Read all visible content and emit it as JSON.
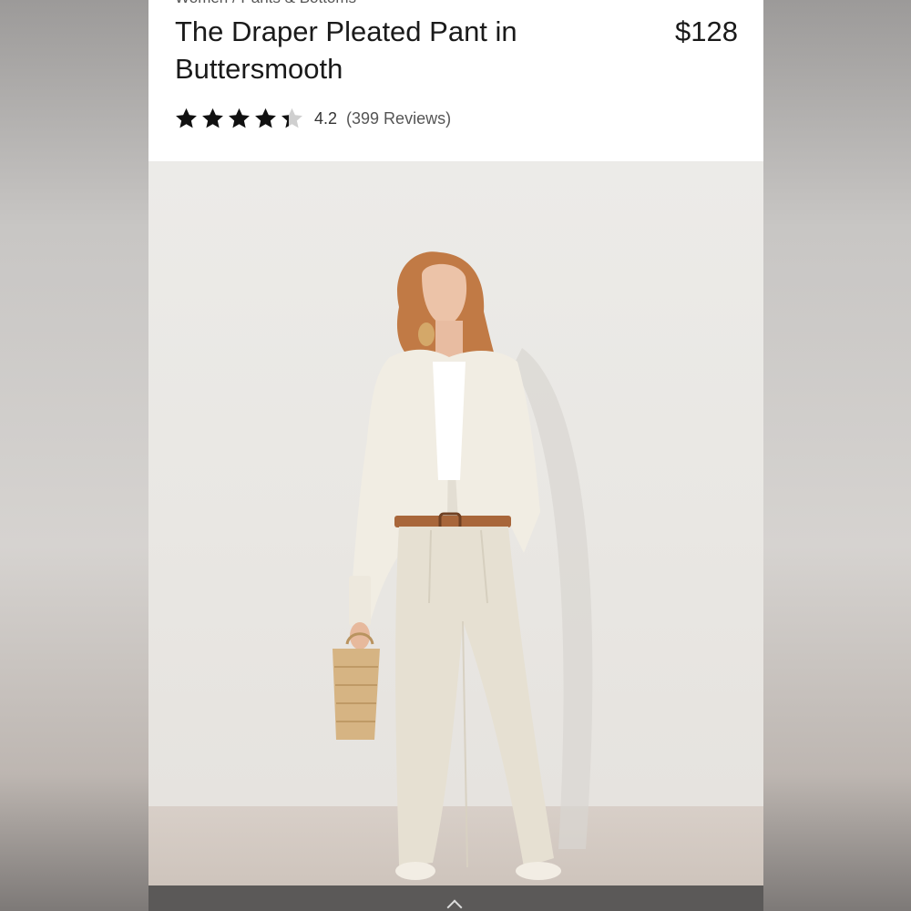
{
  "breadcrumb": {
    "text": "Women / Pants & Bottoms"
  },
  "product": {
    "title": "The Draper Pleated Pant in Buttersmooth",
    "price": "$128",
    "rating_value": "4.2",
    "rating_count": "(399 Reviews)",
    "rating_stars": 4.2,
    "image_alt": "Model wearing The Draper Pleated Pant in Buttersmooth"
  },
  "colors": {
    "text": "#1a1a1a",
    "star": "#111111",
    "star_empty": "#cfcfcf",
    "backdrop": "#ebe9e6",
    "floor": "#d4cac2"
  },
  "icons": {
    "star_full": "star-icon",
    "star_partial": "star-half-icon",
    "nav": "chevron-up-icon"
  }
}
